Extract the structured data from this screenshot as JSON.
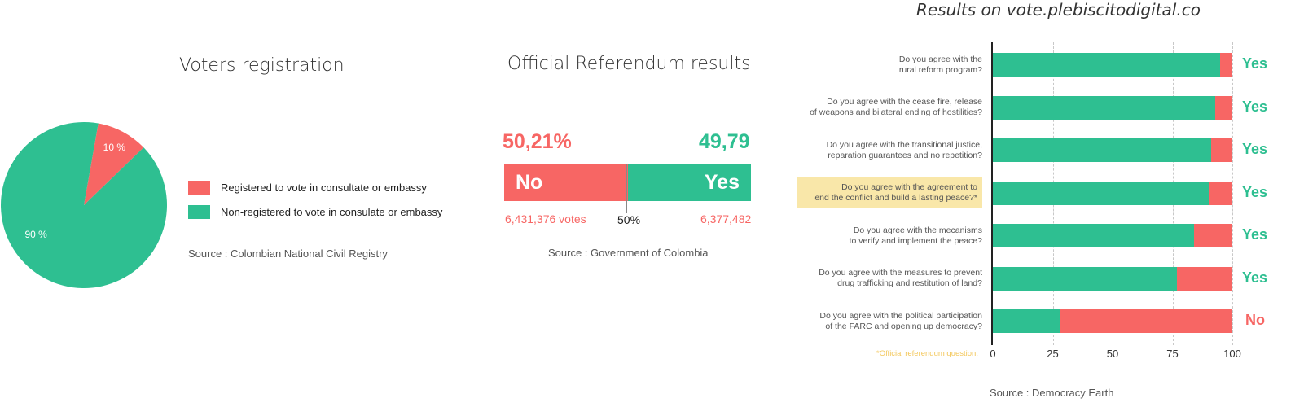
{
  "colors": {
    "green": "#2ebf91",
    "red": "#f76664",
    "highlight": "#f9e7a9",
    "footnote": "#f3c75a"
  },
  "voters": {
    "title": "Voters registration",
    "legend": [
      {
        "label": "Registered to vote in consultate or embassy",
        "color": "#f76664"
      },
      {
        "label": "Non-registered to vote in consulate  or embassy",
        "color": "#2ebf91"
      }
    ],
    "source": "Source : Colombian National Civil Registry"
  },
  "referendum": {
    "title": "Official Referendum results",
    "no_pct": "50,21%",
    "yes_pct": "49,79",
    "no_label": "No",
    "yes_label": "Yes",
    "no_votes": "6,431,376 votes",
    "yes_votes": "6,377,482",
    "mid_label": "50%",
    "source": "Source : Government of Colombia"
  },
  "digital": {
    "title": "Results on vote.plebiscitodigital.co",
    "footnote": "*Official referendum question.",
    "source": "Source : Democracy Earth"
  },
  "chart_data": [
    {
      "type": "pie",
      "title": "Voters registration",
      "categories": [
        "Registered to vote in consultate or embassy",
        "Non-registered to vote in consulate  or embassy"
      ],
      "values": [
        10,
        90
      ],
      "labels": [
        "10 %",
        "90 %"
      ],
      "colors": [
        "#f76664",
        "#2ebf91"
      ],
      "legend_position": "right"
    },
    {
      "type": "bar",
      "orientation": "horizontal-stacked",
      "title": "Official Referendum results",
      "categories": [
        "No",
        "Yes"
      ],
      "values": [
        50.21,
        49.79
      ],
      "colors": [
        "#f76664",
        "#2ebf91"
      ],
      "reference_line": 50
    },
    {
      "type": "bar",
      "orientation": "horizontal-stacked",
      "title": "Results on vote.plebiscitodigital.co",
      "xlim": [
        0,
        100
      ],
      "xticks": [
        0,
        25,
        50,
        75,
        100
      ],
      "grid": true,
      "categories": [
        [
          "Do you agree with the",
          "rural reform program?"
        ],
        [
          "Do you agree with the cease fire, release",
          "of weapons and bilateral ending of hostilities?"
        ],
        [
          "Do you agree with the transitional justice,",
          "reparation guarantees and no repetition?"
        ],
        [
          "Do you agree with the agreement to",
          "end the conflict and build a lasting peace?*"
        ],
        [
          "Do you agree with the mecanisms",
          "to verify and implement the peace?"
        ],
        [
          "Do you agree with the measures to prevent",
          "drug trafficking and restitution of land?"
        ],
        [
          "Do you agree with the political participation",
          "of the FARC and opening up democracy?"
        ]
      ],
      "highlighted_index": 3,
      "series": [
        {
          "name": "Yes",
          "color": "#2ebf91",
          "values": [
            95,
            93,
            91,
            90,
            84,
            77,
            28
          ]
        },
        {
          "name": "No",
          "color": "#f76664",
          "values": [
            5,
            7,
            9,
            10,
            16,
            23,
            72
          ]
        }
      ],
      "verdicts": [
        "Yes",
        "Yes",
        "Yes",
        "Yes",
        "Yes",
        "Yes",
        "No"
      ]
    }
  ]
}
